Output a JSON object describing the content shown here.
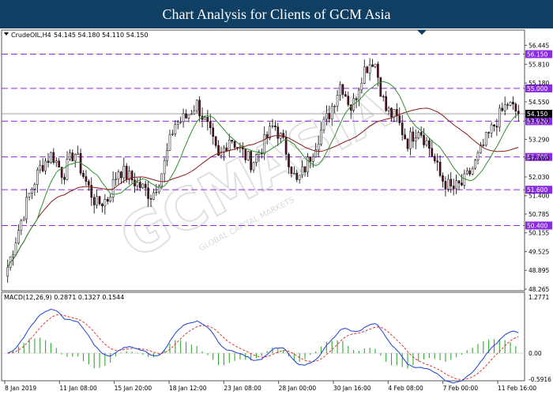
{
  "banner": {
    "title": "Chart Analysis for Clients of GCM Asia"
  },
  "instrument": {
    "symbol_tf": "CrudeOIL,H4",
    "ohlc": "54.145 54.180 54.110 54.150"
  },
  "indicator": {
    "label": "MACD(12,26,9) 0.2871 0.1327 0.1544"
  },
  "watermark": {
    "text": "GCMASIA",
    "subtext": "GLOBAL CAPITAL MARKETS"
  },
  "colors": {
    "bull": "#ffffff",
    "bear": "#5c1020",
    "wick": "#000000",
    "ma_fast": "#2f8f2f",
    "ma_slow": "#8b1a1a",
    "level": "#8a2be2",
    "price_tag": "#000000",
    "macd_line": "#1c3fd6",
    "signal_line": "#e0201e",
    "hist": "#33a833"
  },
  "chart_data": [
    {
      "type": "candlestick",
      "title": "CrudeOIL,H4",
      "ylim": [
        48.265,
        56.8
      ],
      "y_ticks": [
        "56.445",
        "55.810",
        "55.180",
        "54.550",
        "53.920",
        "53.290",
        "52.660",
        "52.030",
        "51.400",
        "50.785",
        "50.155",
        "49.525",
        "48.895",
        "48.265"
      ],
      "x_ticks": [
        "8 Jan 2019",
        "11 Jan 08:00",
        "15 Jan 20:00",
        "18 Jan 12:00",
        "23 Jan 08:00",
        "28 Jan 00:00",
        "30 Jan 16:00",
        "4 Feb 08:00",
        "7 Feb 00:00",
        "11 Feb 16:00"
      ],
      "levels": [
        "56.150",
        "55.000",
        "53.900",
        "52.700",
        "51.600",
        "50.400"
      ],
      "current_price": "54.150",
      "close_anchors": [
        49.0,
        50.3,
        51.5,
        52.4,
        52.8,
        52.1,
        52.9,
        51.9,
        51.1,
        51.3,
        52.3,
        52.0,
        51.7,
        51.4,
        52.3,
        53.8,
        54.0,
        54.5,
        53.7,
        52.6,
        53.4,
        52.9,
        52.5,
        53.1,
        53.8,
        53.0,
        51.8,
        52.5,
        53.4,
        54.2,
        55.2,
        54.3,
        55.6,
        56.0,
        54.3,
        54.0,
        53.2,
        53.7,
        53.0,
        52.0,
        51.6,
        51.8,
        52.4,
        53.2,
        53.9,
        54.5,
        54.15
      ],
      "ma_fast_label": "MA fast",
      "ma_slow_label": "MA slow"
    },
    {
      "type": "macd",
      "title": "MACD(12,26,9)",
      "ylim": [
        -0.5916,
        1.2771
      ],
      "y_ticks": [
        "1.2771",
        "0.00",
        "-0.5916"
      ],
      "macd": 0.2871,
      "signal": 0.1327,
      "hist": 0.1544
    }
  ]
}
